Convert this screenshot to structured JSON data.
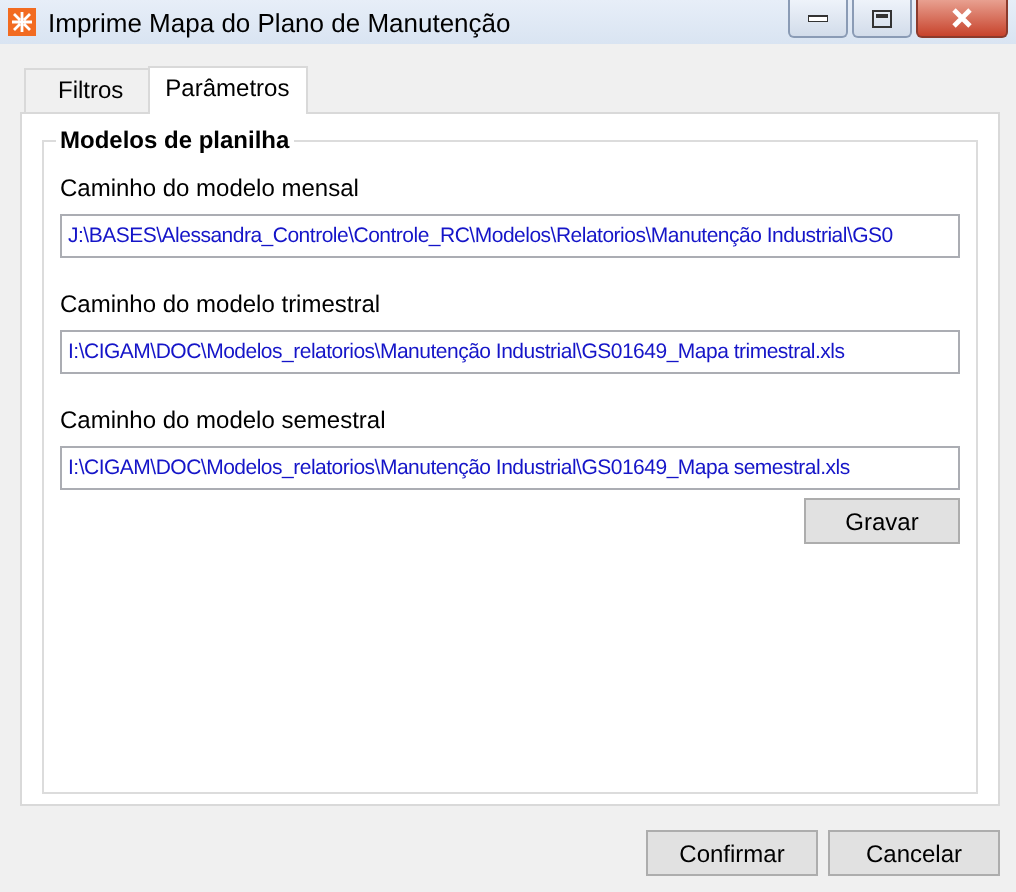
{
  "window": {
    "title": "Imprime Mapa do Plano de Manutenção"
  },
  "tabs": [
    {
      "label": "Filtros",
      "selected": false
    },
    {
      "label": "Parâmetros",
      "selected": true
    }
  ],
  "group": {
    "title": "Modelos de planilha",
    "fields": [
      {
        "label": "Caminho do modelo mensal",
        "value": "J:\\BASES\\Alessandra_Controle\\Controle_RC\\Modelos\\Relatorios\\Manutenção Industrial\\GS0"
      },
      {
        "label": "Caminho do modelo trimestral",
        "value": "I:\\CIGAM\\DOC\\Modelos_relatorios\\Manutenção Industrial\\GS01649_Mapa trimestral.xls"
      },
      {
        "label": "Caminho do modelo semestral",
        "value": "I:\\CIGAM\\DOC\\Modelos_relatorios\\Manutenção Industrial\\GS01649_Mapa semestral.xls"
      }
    ],
    "button": "Gravar"
  },
  "buttons": [
    "Confirmar",
    "Cancelar"
  ]
}
